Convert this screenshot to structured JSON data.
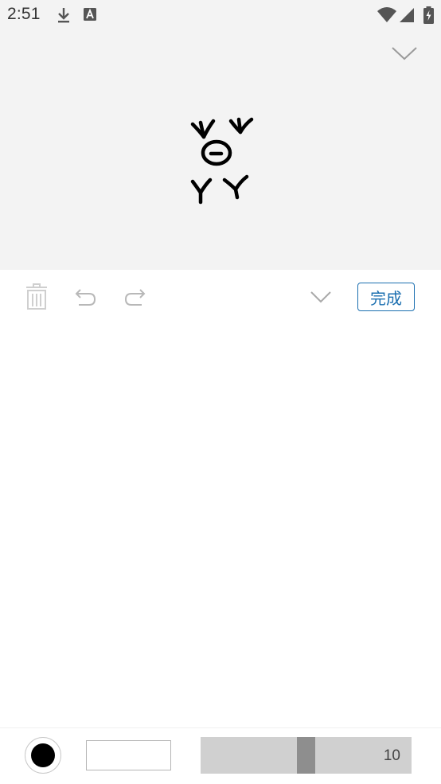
{
  "status_bar": {
    "time": "2:51",
    "icons": [
      "download-icon",
      "text-input-icon",
      "wifi-icon",
      "signal-icon",
      "battery-charging-icon"
    ]
  },
  "preview": {
    "collapse_icon": "chevron-down-icon",
    "drawing": "handwritten-glyph"
  },
  "toolbar": {
    "delete_icon": "trash-icon",
    "undo_icon": "undo-icon",
    "redo_icon": "redo-icon",
    "collapse_icon": "chevron-down-icon",
    "done_label": "完成"
  },
  "bottom_bar": {
    "pen_color": "#000000",
    "stroke_size_fraction": 0.5,
    "stroke_size_value": "10"
  },
  "colors": {
    "accent": "#1b6fb0",
    "panel_background": "#f3f3f3",
    "slider_track": "#d0d0d0",
    "slider_thumb": "#8e8e8e"
  }
}
